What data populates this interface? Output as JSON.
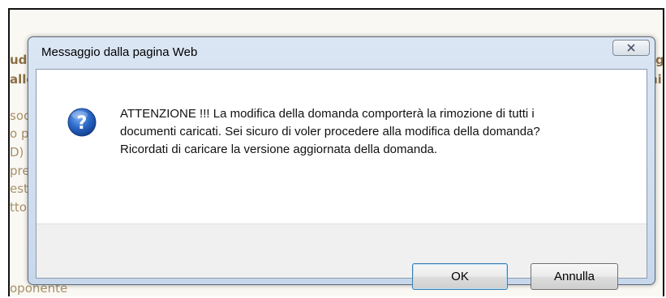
{
  "background_page": {
    "lines": [
      "ud",
      "alle",
      "soc",
      "o p",
      "D)",
      "pre",
      "esta",
      "tto",
      "oponente"
    ],
    "right_fragments": [
      "g",
      "ni."
    ]
  },
  "dialog": {
    "title": "Messaggio dalla pagina Web",
    "close_icon": "close-x-icon",
    "icon": "question-icon",
    "message": "ATTENZIONE !!! La modifica della domanda comporterà la rimozione di tutti i documenti caricati. Sei sicuro di voler procedere alla modifica della domanda? Ricordati di caricare la versione aggiornata della domanda.",
    "ok_label": "OK",
    "cancel_label": "Annulla"
  },
  "colors": {
    "dialog_frame": "#c8d8ec",
    "icon_blue": "#1f5fbf",
    "background_text": "#a7906a"
  }
}
